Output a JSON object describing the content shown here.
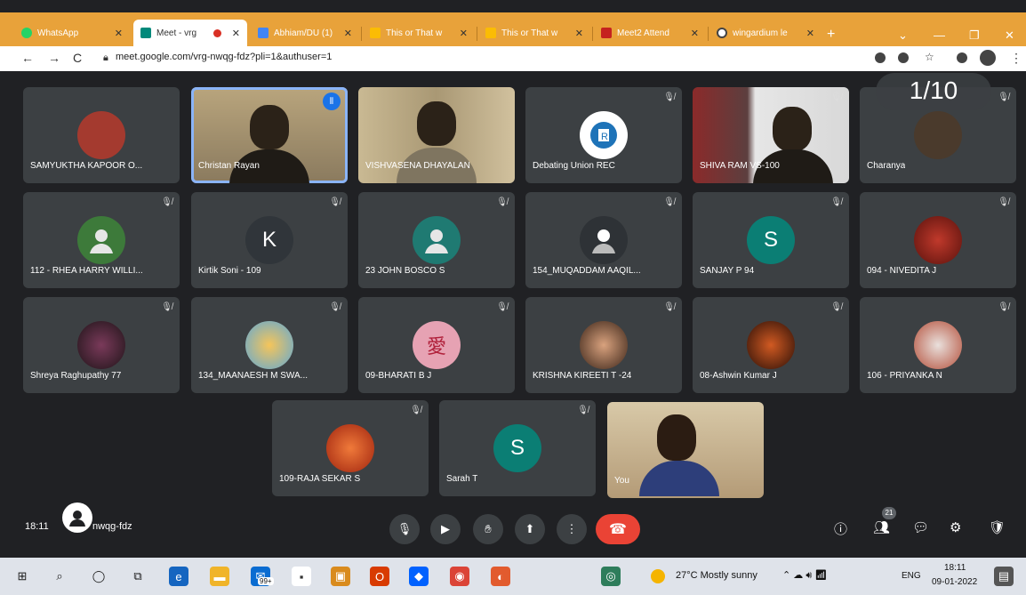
{
  "browser": {
    "tabs": [
      {
        "label": "WhatsApp",
        "color": "#25d366",
        "active": false
      },
      {
        "label": "Meet - vrg",
        "color": "#00897b",
        "active": true
      },
      {
        "label": "Abhiam/DU (1)",
        "color": "#4285f4",
        "active": false
      },
      {
        "label": "This or That w",
        "color": "#fbbc04",
        "active": false
      },
      {
        "label": "This or That w",
        "color": "#fbbc04",
        "active": false
      },
      {
        "label": "Meet2 Attend",
        "color": "#c5221f",
        "active": false
      },
      {
        "label": "wingardium le",
        "color": "#444444",
        "active": false
      }
    ],
    "new_tab": "+",
    "url": "meet.google.com/vrg-nwqg-fdz?pli=1&authuser=1",
    "back": "←",
    "forward": "→",
    "reload": "C"
  },
  "meet": {
    "page_indicator": "1/10",
    "tiles": [
      {
        "name": "SAMYUKTHA KAPOOR O...",
        "kind": "photo",
        "color": "#a43a2f"
      },
      {
        "name": "Christan Rayan",
        "kind": "video",
        "speaking": true
      },
      {
        "name": "VISHVASENA DHAYALAN",
        "kind": "video"
      },
      {
        "name": "Debating Union REC",
        "kind": "logo",
        "color": "#ffffff"
      },
      {
        "name": "SHIVA RAM VS-100",
        "kind": "video"
      },
      {
        "name": "Charanya",
        "kind": "photo",
        "color": "#4a3a2c"
      },
      {
        "name": "112 - RHEA HARRY WILLI...",
        "kind": "default",
        "color": "#3d7a3a"
      },
      {
        "name": "Kirtik Soni - 109",
        "kind": "letter",
        "letter": "K",
        "color": "#30353a"
      },
      {
        "name": "23 JOHN BOSCO S",
        "kind": "default",
        "color": "#1f7a72"
      },
      {
        "name": "154_MUQADDAM AAQIL...",
        "kind": "default",
        "color": "#2e3236"
      },
      {
        "name": "SANJAY P 94",
        "kind": "letter",
        "letter": "S",
        "color": "#0b7e74"
      },
      {
        "name": "094 - NIVEDITA J",
        "kind": "photo",
        "color": "#7a1f17"
      },
      {
        "name": "Shreya Raghupathy 77",
        "kind": "photo",
        "color": "#3a2430"
      },
      {
        "name": "134_MAANAESH M SWA...",
        "kind": "photo",
        "color": "#e4b74c"
      },
      {
        "name": "09-BHARATI B J",
        "kind": "photo",
        "color": "#e6a2b3"
      },
      {
        "name": "KRISHNA KIREETI T -24",
        "kind": "photo",
        "color": "#6b4a36"
      },
      {
        "name": "08-Ashwin Kumar J",
        "kind": "photo",
        "color": "#8a3b1a"
      },
      {
        "name": "106 - PRIYANKA N",
        "kind": "photo",
        "color": "#b44f3a"
      },
      {
        "name": "109-RAJA SEKAR S",
        "kind": "photo",
        "color": "#c93a1e"
      },
      {
        "name": "Sarah T",
        "kind": "letter",
        "letter": "S",
        "color": "#0b7e74"
      },
      {
        "name": "You",
        "kind": "video"
      }
    ],
    "bar": {
      "time": "18:11",
      "code": "nwqg-fdz",
      "people_count": "21"
    }
  },
  "taskbar": {
    "weather": "27°C Mostly sunny",
    "lang": "ENG",
    "time": "18:11",
    "date": "09-01-2022",
    "badge": "99+"
  }
}
